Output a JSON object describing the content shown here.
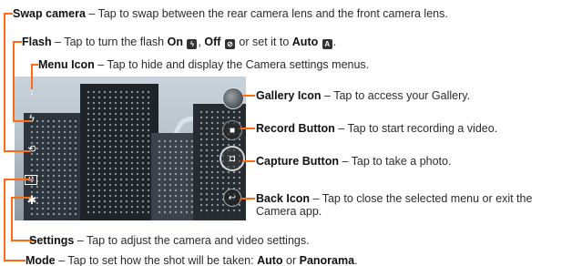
{
  "callouts": {
    "swap": {
      "term": "Swap camera",
      "desc": " – Tap to swap between the rear camera lens and the front camera lens."
    },
    "flash": {
      "term": "Flash",
      "desc_1": " – Tap to turn the flash ",
      "on": "On",
      "sep_1": ", ",
      "off": "Off",
      "desc_2": " or set it to ",
      "auto": "Auto",
      "end": "."
    },
    "menu": {
      "term": "Menu Icon",
      "desc": " – Tap to hide and display the Camera settings menus."
    },
    "gallery": {
      "term": "Gallery Icon",
      "desc": " – Tap to access your Gallery."
    },
    "record": {
      "term": "Record Button",
      "desc": " – Tap to start recording a video."
    },
    "capture": {
      "term": "Capture Button",
      "desc": " – Tap to take a photo."
    },
    "back": {
      "term": "Back Icon",
      "desc": " – Tap to close the selected menu or exit the Camera app."
    },
    "settings": {
      "term": "Settings",
      "desc": " – Tap to adjust the camera and video settings."
    },
    "mode": {
      "term": "Mode",
      "desc_1": " – Tap to set how the shot will be taken: ",
      "auto": "Auto",
      "or": " or ",
      "panorama": "Panorama",
      "end": "."
    }
  },
  "icons": {
    "flash_on": "flash-on-icon",
    "flash_off": "flash-off-icon",
    "flash_auto": "flash-auto-icon"
  },
  "colors": {
    "callout_line": "#ff6a13"
  }
}
